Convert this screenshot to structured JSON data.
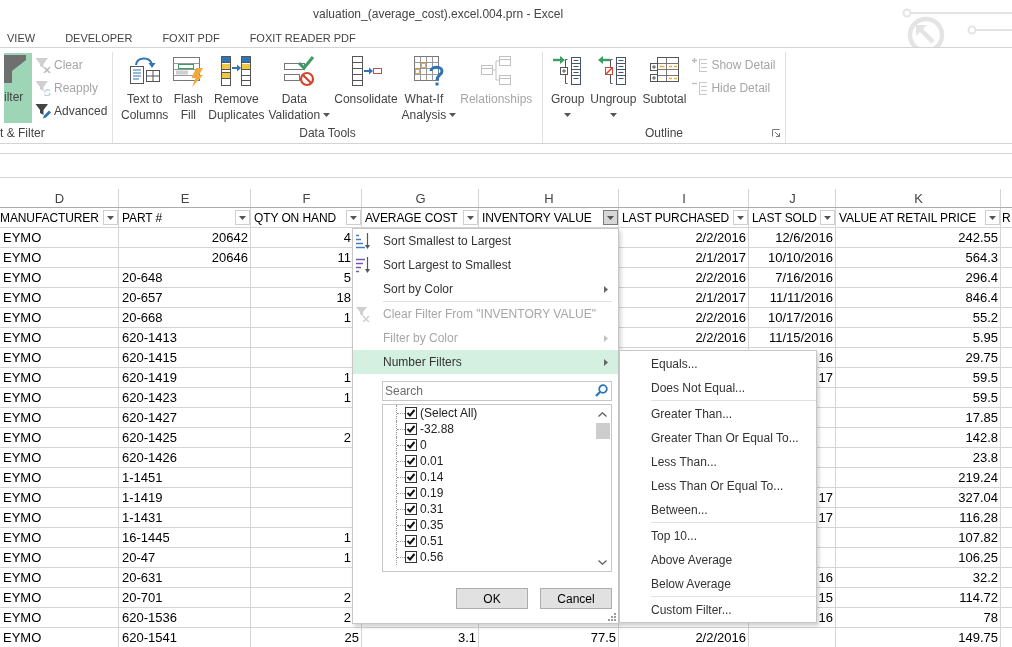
{
  "window": {
    "title": "valuation_(average_cost).excel.004.prn - Excel"
  },
  "ribbon_tabs": [
    {
      "label": "VIEW",
      "selected": false
    },
    {
      "label": "DEVELOPER",
      "selected": false
    },
    {
      "label": "FOXIT PDF",
      "selected": false
    },
    {
      "label": "FOXIT READER PDF",
      "selected": false
    }
  ],
  "ribbon_groups": [
    {
      "label": "t & Filter",
      "launcher": false,
      "items": [
        {
          "kind": "large",
          "lines": [
            "ilter"
          ],
          "on": true,
          "disabled": false,
          "dropdown": false
        },
        {
          "kind": "small",
          "lines": [
            "Clear"
          ],
          "on": false,
          "disabled": true,
          "dropdown": false
        },
        {
          "kind": "small",
          "lines": [
            "Reapply"
          ],
          "on": false,
          "disabled": true,
          "dropdown": false
        },
        {
          "kind": "small",
          "lines": [
            "Advanced"
          ],
          "on": false,
          "disabled": false,
          "dropdown": false
        }
      ]
    },
    {
      "label": "Data Tools",
      "launcher": false,
      "items": [
        {
          "kind": "large",
          "lines": [
            "Text to",
            "Columns"
          ],
          "on": false,
          "disabled": false,
          "dropdown": false
        },
        {
          "kind": "large",
          "lines": [
            "Flash",
            "Fill"
          ],
          "on": false,
          "disabled": false,
          "dropdown": false
        },
        {
          "kind": "large",
          "lines": [
            "Remove",
            "Duplicates"
          ],
          "on": false,
          "disabled": false,
          "dropdown": false
        },
        {
          "kind": "large",
          "lines": [
            "Data",
            "Validation"
          ],
          "on": false,
          "disabled": false,
          "dropdown": true
        },
        {
          "kind": "large",
          "lines": [
            "Consolidate"
          ],
          "on": false,
          "disabled": false,
          "dropdown": false
        },
        {
          "kind": "large",
          "lines": [
            "What-If",
            "Analysis"
          ],
          "on": false,
          "disabled": false,
          "dropdown": true
        },
        {
          "kind": "large",
          "lines": [
            "Relationships"
          ],
          "on": false,
          "disabled": true,
          "dropdown": false
        }
      ]
    },
    {
      "label": "Outline",
      "launcher": true,
      "items": [
        {
          "kind": "large",
          "lines": [
            "Group"
          ],
          "on": false,
          "disabled": false,
          "dropdown": true
        },
        {
          "kind": "large",
          "lines": [
            "Ungroup"
          ],
          "on": false,
          "disabled": false,
          "dropdown": true
        },
        {
          "kind": "large",
          "lines": [
            "Subtotal"
          ],
          "on": false,
          "disabled": false,
          "dropdown": false
        },
        {
          "kind": "small",
          "lines": [
            "Show Detail"
          ],
          "on": false,
          "disabled": true,
          "dropdown": false
        },
        {
          "kind": "small",
          "lines": [
            "Hide Detail"
          ],
          "on": false,
          "disabled": true,
          "dropdown": false
        }
      ]
    }
  ],
  "sheet": {
    "columns": [
      {
        "letter": "D",
        "title": "MANUFACTURER",
        "has_filter": true,
        "filter_open": false
      },
      {
        "letter": "E",
        "title": "PART #",
        "has_filter": true,
        "filter_open": false
      },
      {
        "letter": "F",
        "title": "QTY ON HAND",
        "has_filter": true,
        "filter_open": false
      },
      {
        "letter": "G",
        "title": "AVERAGE COST",
        "has_filter": true,
        "filter_open": false
      },
      {
        "letter": "H",
        "title": "INVENTORY VALUE",
        "has_filter": true,
        "filter_open": true
      },
      {
        "letter": "I",
        "title": "LAST PURCHASED",
        "has_filter": true,
        "filter_open": false
      },
      {
        "letter": "J",
        "title": "LAST SOLD",
        "has_filter": true,
        "filter_open": false
      },
      {
        "letter": "K",
        "title": "VALUE AT RETAIL PRICE",
        "has_filter": true,
        "filter_open": false
      },
      {
        "title": "R",
        "has_filter": false
      }
    ],
    "rows": [
      [
        {
          "text": "EYMO",
          "kind": "text"
        },
        {
          "text": "20642",
          "kind": "number"
        },
        {
          "text": "4",
          "kind": "number"
        },
        null,
        null,
        {
          "text": "2/2/2016",
          "kind": "date"
        },
        {
          "text": "12/6/2016",
          "kind": "date"
        },
        {
          "text": "242.55",
          "kind": "number"
        }
      ],
      [
        {
          "text": "EYMO",
          "kind": "text"
        },
        {
          "text": "20646",
          "kind": "number"
        },
        {
          "text": "11",
          "kind": "number"
        },
        null,
        null,
        {
          "text": "2/1/2017",
          "kind": "date"
        },
        {
          "text": "10/10/2016",
          "kind": "date"
        },
        {
          "text": "564.3",
          "kind": "number"
        }
      ],
      [
        {
          "text": "EYMO",
          "kind": "text"
        },
        {
          "text": "20-648",
          "kind": "text"
        },
        {
          "text": "5",
          "kind": "number"
        },
        null,
        null,
        {
          "text": "2/2/2016",
          "kind": "date"
        },
        {
          "text": "7/16/2016",
          "kind": "date"
        },
        {
          "text": "296.4",
          "kind": "number"
        }
      ],
      [
        {
          "text": "EYMO",
          "kind": "text"
        },
        {
          "text": "20-657",
          "kind": "text"
        },
        {
          "text": "18",
          "kind": "number"
        },
        null,
        null,
        {
          "text": "2/1/2017",
          "kind": "date"
        },
        {
          "text": "11/11/2016",
          "kind": "date"
        },
        {
          "text": "846.4",
          "kind": "number"
        }
      ],
      [
        {
          "text": "EYMO",
          "kind": "text"
        },
        {
          "text": "20-668",
          "kind": "text"
        },
        {
          "text": "1",
          "kind": "number"
        },
        null,
        null,
        {
          "text": "2/2/2016",
          "kind": "date"
        },
        {
          "text": "10/17/2016",
          "kind": "date"
        },
        {
          "text": "55.2",
          "kind": "number"
        }
      ],
      [
        {
          "text": "EYMO",
          "kind": "text"
        },
        {
          "text": "620-1413",
          "kind": "text"
        },
        null,
        null,
        null,
        {
          "text": "2/2/2016",
          "kind": "date"
        },
        {
          "text": "11/15/2016",
          "kind": "date"
        },
        {
          "text": "5.95",
          "kind": "number"
        }
      ],
      [
        {
          "text": "EYMO",
          "kind": "text"
        },
        {
          "text": "620-1415",
          "kind": "text"
        },
        null,
        null,
        null,
        null,
        {
          "text": "16",
          "kind": "date"
        },
        {
          "text": "29.75",
          "kind": "number"
        }
      ],
      [
        {
          "text": "EYMO",
          "kind": "text"
        },
        {
          "text": "620-1419",
          "kind": "text"
        },
        {
          "text": "1",
          "kind": "number"
        },
        null,
        null,
        null,
        {
          "text": "17",
          "kind": "date"
        },
        {
          "text": "59.5",
          "kind": "number"
        }
      ],
      [
        {
          "text": "EYMO",
          "kind": "text"
        },
        {
          "text": "620-1423",
          "kind": "text"
        },
        {
          "text": "1",
          "kind": "number"
        },
        null,
        null,
        null,
        null,
        {
          "text": "59.5",
          "kind": "number"
        }
      ],
      [
        {
          "text": "EYMO",
          "kind": "text"
        },
        {
          "text": "620-1427",
          "kind": "text"
        },
        null,
        null,
        null,
        null,
        null,
        {
          "text": "17.85",
          "kind": "number"
        }
      ],
      [
        {
          "text": "EYMO",
          "kind": "text"
        },
        {
          "text": "620-1425",
          "kind": "text"
        },
        {
          "text": "2",
          "kind": "number"
        },
        null,
        null,
        null,
        null,
        {
          "text": "142.8",
          "kind": "number"
        }
      ],
      [
        {
          "text": "EYMO",
          "kind": "text"
        },
        {
          "text": "620-1426",
          "kind": "text"
        },
        null,
        null,
        null,
        null,
        null,
        {
          "text": "23.8",
          "kind": "number"
        }
      ],
      [
        {
          "text": "EYMO",
          "kind": "text"
        },
        {
          "text": "1-1451",
          "kind": "text"
        },
        null,
        null,
        null,
        null,
        null,
        {
          "text": "219.24",
          "kind": "number"
        }
      ],
      [
        {
          "text": "EYMO",
          "kind": "text"
        },
        {
          "text": "1-1419",
          "kind": "text"
        },
        null,
        null,
        null,
        null,
        {
          "text": "17",
          "kind": "date"
        },
        {
          "text": "327.04",
          "kind": "number"
        }
      ],
      [
        {
          "text": "EYMO",
          "kind": "text"
        },
        {
          "text": "1-1431",
          "kind": "text"
        },
        null,
        null,
        null,
        null,
        {
          "text": "17",
          "kind": "date"
        },
        {
          "text": "116.28",
          "kind": "number"
        }
      ],
      [
        {
          "text": "EYMO",
          "kind": "text"
        },
        {
          "text": "16-1445",
          "kind": "text"
        },
        {
          "text": "1",
          "kind": "number"
        },
        null,
        null,
        null,
        null,
        {
          "text": "107.82",
          "kind": "number"
        }
      ],
      [
        {
          "text": "EYMO",
          "kind": "text"
        },
        {
          "text": "20-47",
          "kind": "text"
        },
        {
          "text": "1",
          "kind": "number"
        },
        null,
        null,
        null,
        null,
        {
          "text": "106.25",
          "kind": "number"
        }
      ],
      [
        {
          "text": "EYMO",
          "kind": "text"
        },
        {
          "text": "20-631",
          "kind": "text"
        },
        null,
        null,
        null,
        null,
        {
          "text": "16",
          "kind": "date"
        },
        {
          "text": "32.2",
          "kind": "number"
        }
      ],
      [
        {
          "text": "EYMO",
          "kind": "text"
        },
        {
          "text": "20-701",
          "kind": "text"
        },
        {
          "text": "2",
          "kind": "number"
        },
        null,
        null,
        null,
        {
          "text": "15",
          "kind": "date"
        },
        {
          "text": "114.72",
          "kind": "number"
        }
      ],
      [
        {
          "text": "EYMO",
          "kind": "text"
        },
        {
          "text": "620-1536",
          "kind": "text"
        },
        {
          "text": "2",
          "kind": "number"
        },
        null,
        null,
        null,
        {
          "text": "16",
          "kind": "date"
        },
        {
          "text": "78",
          "kind": "number"
        }
      ],
      [
        {
          "text": "EYMO",
          "kind": "text"
        },
        {
          "text": "620-1541",
          "kind": "text"
        },
        {
          "text": "25",
          "kind": "number"
        },
        {
          "text": "3.1",
          "kind": "number"
        },
        {
          "text": "77.5",
          "kind": "number"
        },
        {
          "text": "2/2/2016",
          "kind": "date"
        },
        null,
        {
          "text": "149.75",
          "kind": "number"
        }
      ]
    ]
  },
  "filter_menu": {
    "items": [
      {
        "label": "Sort Smallest to Largest",
        "disabled": false,
        "highlighted": false,
        "submenu": false,
        "separator_before": false
      },
      {
        "label": "Sort Largest to Smallest",
        "disabled": false,
        "highlighted": false,
        "submenu": false,
        "separator_before": false
      },
      {
        "label": "Sort by Color",
        "disabled": false,
        "highlighted": false,
        "submenu": true,
        "separator_before": false
      },
      {
        "label": "Clear Filter From \"INVENTORY VALUE\"",
        "disabled": true,
        "highlighted": false,
        "submenu": false,
        "separator_before": true
      },
      {
        "label": "Filter by Color",
        "disabled": true,
        "highlighted": false,
        "submenu": true,
        "separator_before": false
      },
      {
        "label": "Number Filters",
        "disabled": false,
        "highlighted": true,
        "submenu": true,
        "separator_before": false
      }
    ],
    "search": {
      "placeholder": "Search"
    },
    "values": [
      {
        "label": "(Select All)",
        "checked": true
      },
      {
        "label": "-32.88",
        "checked": true
      },
      {
        "label": "0",
        "checked": true
      },
      {
        "label": "0.01",
        "checked": true
      },
      {
        "label": "0.14",
        "checked": true
      },
      {
        "label": "0.19",
        "checked": true
      },
      {
        "label": "0.31",
        "checked": true
      },
      {
        "label": "0.35",
        "checked": true
      },
      {
        "label": "0.51",
        "checked": true
      },
      {
        "label": "0.56",
        "checked": true
      }
    ],
    "buttons": [
      {
        "label": "OK"
      },
      {
        "label": "Cancel"
      }
    ]
  },
  "number_filters_menu": {
    "items": [
      {
        "label": "Equals...",
        "separator_before": false
      },
      {
        "label": "Does Not Equal...",
        "separator_before": false
      },
      {
        "label": "Greater Than...",
        "separator_before": true
      },
      {
        "label": "Greater Than Or Equal To...",
        "separator_before": false
      },
      {
        "label": "Less Than...",
        "separator_before": false
      },
      {
        "label": "Less Than Or Equal To...",
        "separator_before": false
      },
      {
        "label": "Between...",
        "separator_before": false
      },
      {
        "label": "Top 10...",
        "separator_before": true
      },
      {
        "label": "Above Average",
        "separator_before": false
      },
      {
        "label": "Below Average",
        "separator_before": false
      },
      {
        "label": "Custom Filter...",
        "separator_before": true
      }
    ]
  }
}
